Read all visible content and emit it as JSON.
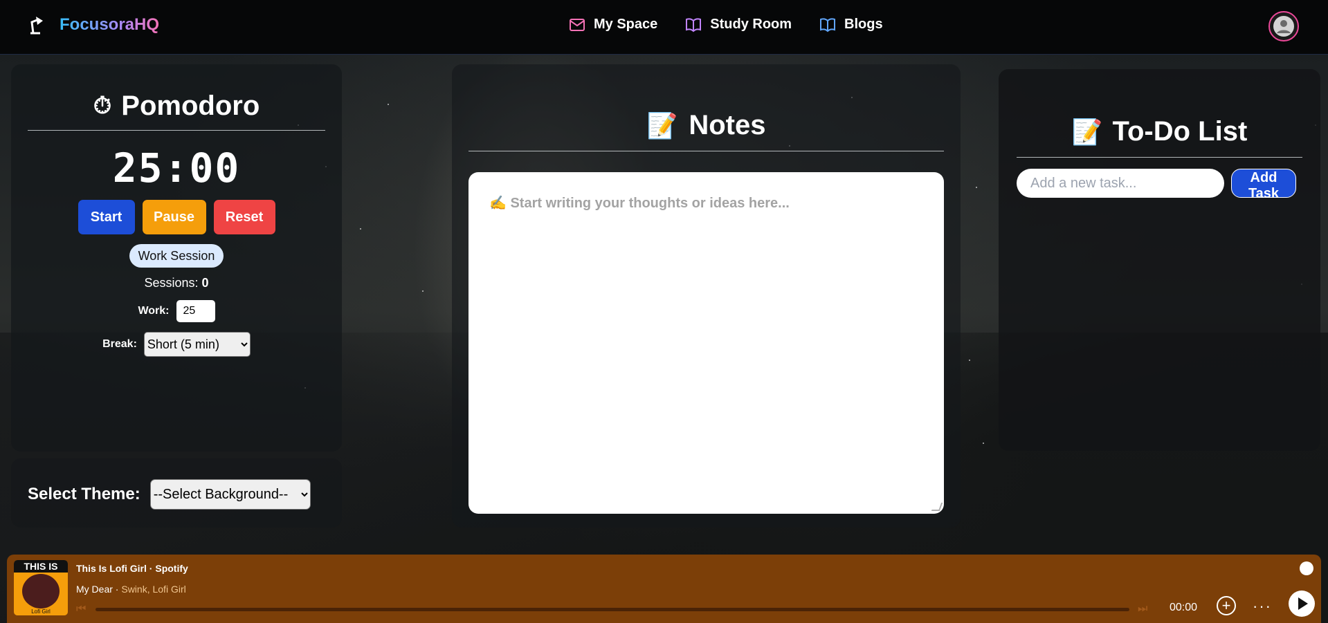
{
  "app": {
    "brand": "FocusoraHQ"
  },
  "nav": [
    {
      "label": "My Space",
      "icon": "mail-icon",
      "color": "#f472b6"
    },
    {
      "label": "Study Room",
      "icon": "book-icon",
      "color": "#c084fc"
    },
    {
      "label": "Blogs",
      "icon": "book-icon",
      "color": "#60a5fa"
    }
  ],
  "pomodoro": {
    "title": "Pomodoro",
    "time": "25:00",
    "start": "Start",
    "pause": "Pause",
    "reset": "Reset",
    "mode": "Work Session",
    "sessions_label": "Sessions:",
    "sessions_value": "0",
    "work_label": "Work:",
    "work_value": "25",
    "break_label": "Break:",
    "break_selected": "Short (5 min)"
  },
  "theme": {
    "label": "Select Theme:",
    "selected": "--Select Background--"
  },
  "notes": {
    "title": "Notes",
    "placeholder": "✍️ Start writing your thoughts or ideas here..."
  },
  "todo": {
    "title": "To-Do List",
    "placeholder": "Add a new task...",
    "add": "Add Task"
  },
  "player": {
    "playlist": "This Is Lofi Girl",
    "source": "Spotify",
    "track": "My Dear",
    "artists": "Swink, Lofi Girl",
    "time": "00:00",
    "cover_top": "THIS IS",
    "cover_bottom": "Lofi Girl"
  },
  "colors": {
    "start": "#1d4ed8",
    "pause": "#f59e0b",
    "reset": "#ef4444",
    "player_bg": "#7c3f08",
    "avatar_ring": "#ec4899"
  }
}
